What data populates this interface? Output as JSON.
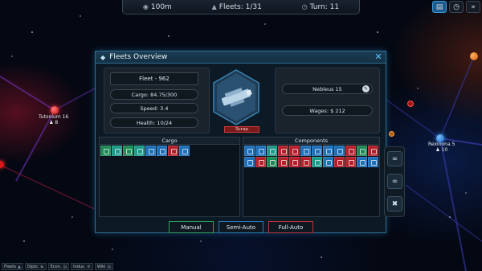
{
  "hud": {
    "credits": "100m",
    "fleets": "Fleets: 1/31",
    "turn": "Turn: 11",
    "right_buttons": [
      "book-icon",
      "clock-icon",
      "forward-icon"
    ]
  },
  "planets": [
    {
      "name": "Tutonium 16",
      "pop": "8"
    },
    {
      "name": "Rexinona 5",
      "pop": "10"
    }
  ],
  "dialog": {
    "title": "Fleets Overview",
    "fleet_name": "Fleet - 962",
    "cargo": "Cargo: 84.75/300",
    "speed": "Speed: 3.4",
    "health": "Health: 10/24",
    "scrap_label": "Scrap",
    "ship_name": "Nebleus 15",
    "wages": "Wages: $ 212",
    "cargo_header": "Cargo",
    "components_header": "Components",
    "cargo_slots": [
      "green",
      "teal",
      "green",
      "teal",
      "blue",
      "blue",
      "red",
      "blue"
    ],
    "component_slots": [
      "blue",
      "blue",
      "teal",
      "red",
      "red",
      "blue",
      "blue",
      "blue",
      "blue",
      "red",
      "green",
      "red",
      "blue",
      "red",
      "green",
      "red",
      "red",
      "red",
      "teal",
      "blue",
      "red",
      "red",
      "blue",
      "blue"
    ],
    "modes": [
      "Manual",
      "Semi-Auto",
      "Full-Auto"
    ]
  },
  "bottom_bar": [
    "Fleets",
    "Diplo.",
    "Econ.",
    "Indus.",
    "Wiki"
  ],
  "colors": {
    "accent": "#2f6f92",
    "manual": "#2fa05a",
    "semi": "#2a78b8",
    "full": "#c0303a"
  }
}
